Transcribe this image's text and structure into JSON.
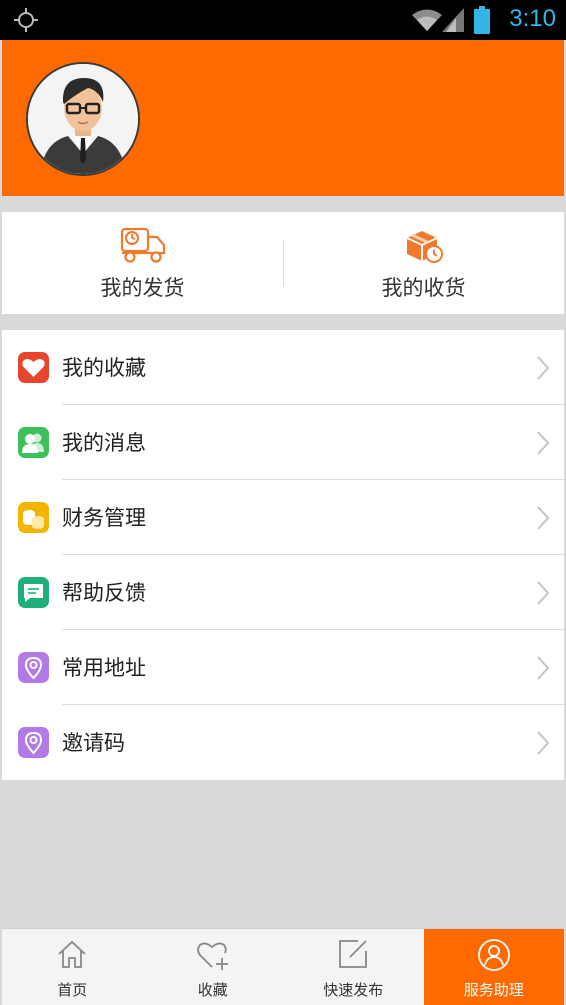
{
  "status_bar": {
    "time": "3:10"
  },
  "profile": {
    "avatar_icon": "user-avatar"
  },
  "shortcuts": [
    {
      "label": "我的发货",
      "icon": "delivery-truck-icon"
    },
    {
      "label": "我的收货",
      "icon": "package-clock-icon"
    }
  ],
  "menu": [
    {
      "label": "我的收藏",
      "icon": "heart-icon",
      "color": "#e8452e"
    },
    {
      "label": "我的消息",
      "icon": "contacts-icon",
      "color": "#3cc05a"
    },
    {
      "label": "财务管理",
      "icon": "coins-icon",
      "color": "#f5b400"
    },
    {
      "label": "帮助反馈",
      "icon": "chat-icon",
      "color": "#1fb07a"
    },
    {
      "label": "常用地址",
      "icon": "location-pin-icon",
      "color": "#b27ae6"
    },
    {
      "label": "邀请码",
      "icon": "location-pin-icon",
      "color": "#b27ae6"
    }
  ],
  "tabbar": [
    {
      "label": "首页",
      "icon": "home-icon",
      "active": false
    },
    {
      "label": "收藏",
      "icon": "heart-plus-icon",
      "active": false
    },
    {
      "label": "快速发布",
      "icon": "edit-icon",
      "active": false
    },
    {
      "label": "服务助理",
      "icon": "person-circle-icon",
      "active": true
    }
  ],
  "colors": {
    "accent": "#ff6a00",
    "status_text": "#33b5e5"
  }
}
